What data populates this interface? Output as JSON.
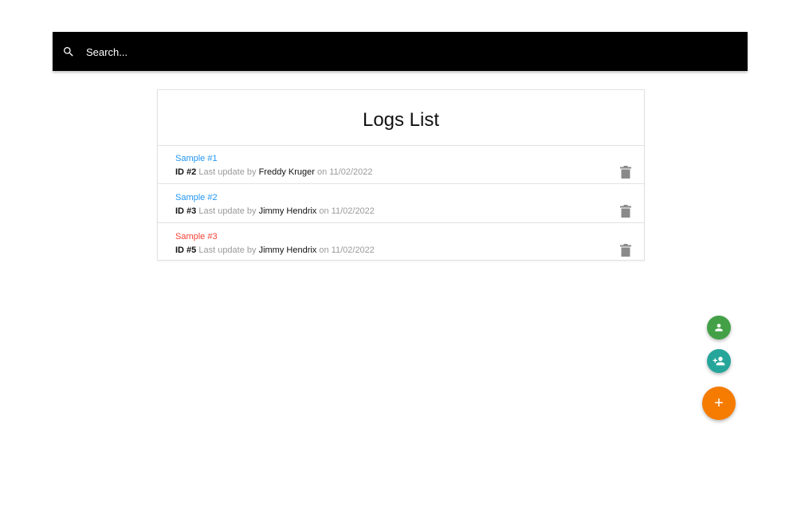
{
  "search": {
    "placeholder": "Search...",
    "icon": "search-icon"
  },
  "card": {
    "title": "Logs List"
  },
  "logs": [
    {
      "title": "Sample #1",
      "title_color": "#2196f3",
      "id": "ID #2",
      "last_update_text": " Last update by ",
      "author": "Freddy Kruger",
      "on_text": " on ",
      "date": "11/02/2022",
      "action_icon": "trash-icon"
    },
    {
      "title": "Sample #2",
      "title_color": "#2196f3",
      "id": "ID #3",
      "last_update_text": " Last update by ",
      "author": "Jimmy Hendrix",
      "on_text": " on ",
      "date": "11/02/2022",
      "action_icon": "trash-icon"
    },
    {
      "title": "Sample #3",
      "title_color": "#f44336",
      "id": "ID #5",
      "last_update_text": " Last update by ",
      "author": "Jimmy Hendrix",
      "on_text": " on ",
      "date": "11/02/2022",
      "action_icon": "trash-icon"
    }
  ],
  "fabs": {
    "user": {
      "icon": "user-icon",
      "color": "#43a047"
    },
    "add_user": {
      "icon": "add-user-icon",
      "color": "#26a69a"
    },
    "add": {
      "icon": "plus-icon",
      "label": "+",
      "color": "#f57c00"
    }
  },
  "colors": {
    "search_bar": "#000000",
    "divider": "#e2e2e2",
    "meta_text": "#9a9a9a",
    "trash_icon": "#8a8a8a"
  }
}
